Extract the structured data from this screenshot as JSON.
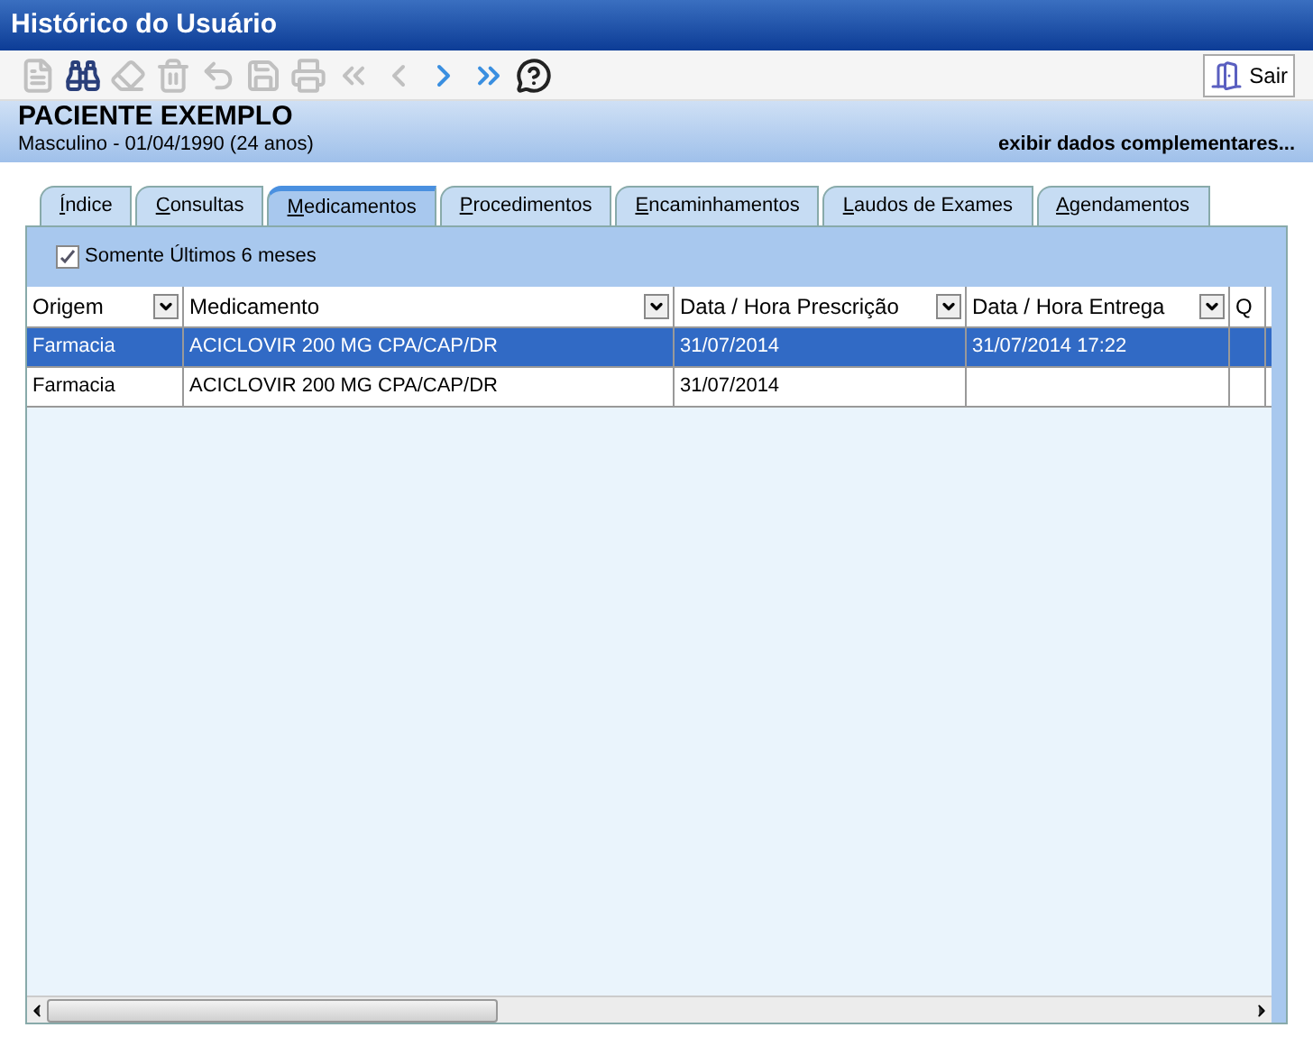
{
  "window": {
    "title": "Histórico do Usuário"
  },
  "toolbar": [
    {
      "kind": "document",
      "disabled": true
    },
    {
      "kind": "binoculars",
      "disabled": false
    },
    {
      "kind": "eraser",
      "disabled": true
    },
    {
      "kind": "trash",
      "disabled": true
    },
    {
      "kind": "undo",
      "disabled": true
    },
    {
      "kind": "save",
      "disabled": true
    },
    {
      "kind": "printer",
      "disabled": true
    },
    {
      "kind": "first",
      "disabled": true
    },
    {
      "kind": "previous",
      "disabled": true
    },
    {
      "kind": "next",
      "disabled": false
    },
    {
      "kind": "last",
      "disabled": false
    },
    {
      "kind": "help",
      "disabled": false
    }
  ],
  "exit_button": {
    "label": "Sair"
  },
  "patient": {
    "name": "PACIENTE EXEMPLO",
    "details": "Masculino - 01/04/1990 (24 anos)",
    "more_link": "exibir dados complementares..."
  },
  "tabs": [
    {
      "label": "Índice",
      "selected": false
    },
    {
      "label": "Consultas",
      "selected": false
    },
    {
      "label": "Medicamentos",
      "selected": true
    },
    {
      "label": "Procedimentos",
      "selected": false
    },
    {
      "label": "Encaminhamentos",
      "selected": false
    },
    {
      "label": "Laudos de Exames",
      "selected": false
    },
    {
      "label": "Agendamentos",
      "selected": false
    }
  ],
  "filter": {
    "label": "Somente Últimos 6 meses",
    "checked": true
  },
  "table": {
    "columns": [
      "Origem",
      "Medicamento",
      "Data / Hora Prescrição",
      "Data / Hora Entrega",
      "Q"
    ],
    "rows": [
      {
        "selected": true,
        "cells": [
          "Farmacia",
          "ACICLOVIR 200 MG CPA/CAP/DR",
          "31/07/2014",
          "31/07/2014 17:22",
          ""
        ]
      },
      {
        "selected": false,
        "cells": [
          "Farmacia",
          "ACICLOVIR 200 MG CPA/CAP/DR",
          "31/07/2014",
          "",
          ""
        ]
      }
    ]
  }
}
